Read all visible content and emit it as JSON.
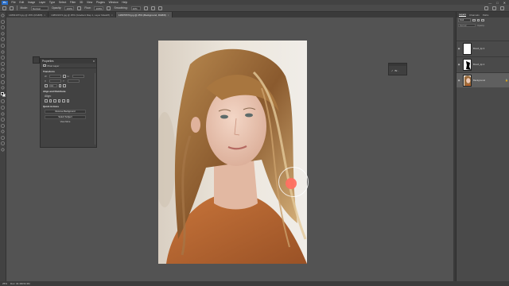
{
  "app": {
    "logo": "Ps"
  },
  "menu": [
    "File",
    "Edit",
    "Image",
    "Layer",
    "Type",
    "Select",
    "Filter",
    "3D",
    "View",
    "Plugins",
    "Window",
    "Help"
  ],
  "window_controls": [
    "—",
    "□",
    "✕"
  ],
  "options": {
    "mode_label": "Mode:",
    "mode_value": "Normal",
    "opacity_label": "Opacity:",
    "opacity_value": "100%",
    "flow_label": "Flow:",
    "flow_value": "100%",
    "smoothing_label": "Smoothing:",
    "smoothing_value": "10%"
  },
  "tabs": [
    {
      "label": "148931973.jpg @ 25% (RGB/8)",
      "active": false
    },
    {
      "label": "148931974.jpg @ 25% (Gradient Map 1, Layer Mask/8)",
      "active": false
    },
    {
      "label": "148976570.jpg @ 25% (Background, RGB/8)",
      "active": true
    }
  ],
  "properties": {
    "title": "Properties",
    "layer_type": "Pixel Layer",
    "transform_title": "Transform",
    "w_label": "W",
    "w_value": "",
    "h_label": "H",
    "h_value": "",
    "x_label": "X",
    "x_value": "",
    "y_label": "Y",
    "y_value": "",
    "angle_value": "0.0",
    "align_title": "Align and Distribute",
    "align_sub": "Align:",
    "quick_title": "Quick Actions",
    "remove_bg": "Remove Background",
    "select_subject": "Select Subject",
    "view_more": "View More"
  },
  "float_widget": {
    "label": "Br..."
  },
  "layers_panel": {
    "tabs": [
      "Layers",
      "Channels",
      "Paths"
    ],
    "kind_label": "Kind",
    "mode_value": "Normal",
    "opacity_label": "Opacity:",
    "layers": [
      {
        "name": "Brush_tip 3",
        "thumb": "white",
        "selected": false
      },
      {
        "name": "Brush_tip 2",
        "thumb": "black-shape",
        "selected": false
      },
      {
        "name": "Background",
        "thumb": "photo",
        "selected": true,
        "locked": true
      }
    ]
  },
  "status": {
    "zoom": "25%",
    "doc_info": "Doc: 34.3M/34.3M"
  },
  "colors": {
    "brush_color": "#ff6f61",
    "foreground": "#000000",
    "background": "#ffffff",
    "workspace": "#535353"
  },
  "tools": [
    "move-tool-icon",
    "marquee-tool-icon",
    "lasso-tool-icon",
    "quick-select-icon",
    "crop-tool-icon",
    "frame-tool-icon",
    "eyedropper-icon",
    "healing-brush-icon",
    "brush-tool-icon",
    "clone-stamp-icon",
    "history-brush-icon",
    "eraser-icon",
    "gradient-icon",
    "blur-icon",
    "dodge-icon",
    "pen-tool-icon",
    "type-tool-icon",
    "path-select-icon",
    "rectangle-tool-icon",
    "hand-tool-icon",
    "zoom-tool-icon",
    "more-tools-icon"
  ]
}
